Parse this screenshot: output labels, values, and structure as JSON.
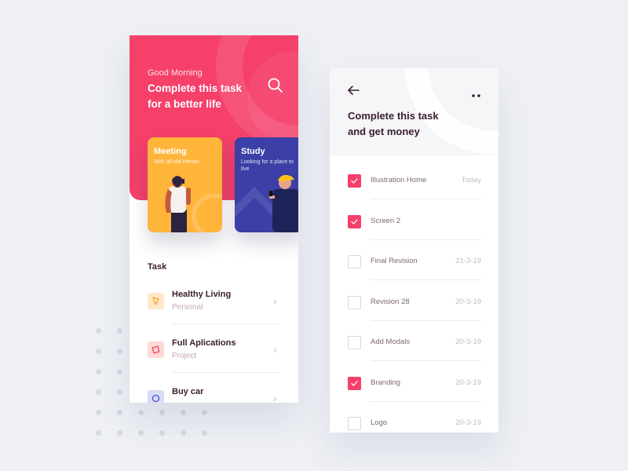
{
  "colors": {
    "accent": "#f5406a",
    "meeting_card": "#ffb43a",
    "study_card": "#3b3fa6",
    "text_dark": "#3a2030",
    "text_muted": "#c4a9b2",
    "background": "#eef0f5"
  },
  "home": {
    "greeting": "Good Morning",
    "headline_line1": "Complete this task",
    "headline_line2": "for a better life",
    "search_icon": "search-icon",
    "cards": [
      {
        "title": "Meeting",
        "subtitle": "With all old friends"
      },
      {
        "title": "Study",
        "subtitle": "Looking for a place to live"
      }
    ],
    "section_title": "Task",
    "tasks": [
      {
        "name": "Healthy Living",
        "category": "Personal",
        "icon": "leaf-icon",
        "icon_color": "#ffe7c9"
      },
      {
        "name": "Full Aplications",
        "category": "Project",
        "icon": "square-icon",
        "icon_color": "#ffd9d3"
      },
      {
        "name": "Buy car",
        "category": "",
        "icon": "circle-icon",
        "icon_color": "#d8dcf6"
      }
    ]
  },
  "detail": {
    "back_icon": "arrow-left-icon",
    "more_icon": "more-icon",
    "title_line1": "Complete this task",
    "title_line2": "and get money",
    "items": [
      {
        "label": "Illustration Home",
        "date": "Today",
        "checked": true
      },
      {
        "label": "Screen 2",
        "date": "",
        "checked": true
      },
      {
        "label": "Final Revision",
        "date": "21-3-19",
        "checked": false
      },
      {
        "label": "Revision 28",
        "date": "20-3-19",
        "checked": false
      },
      {
        "label": "Add Modals",
        "date": "20-3-19",
        "checked": false
      },
      {
        "label": "Branding",
        "date": "20-3-19",
        "checked": true
      },
      {
        "label": "Logo",
        "date": "20-3-19",
        "checked": false
      }
    ]
  }
}
